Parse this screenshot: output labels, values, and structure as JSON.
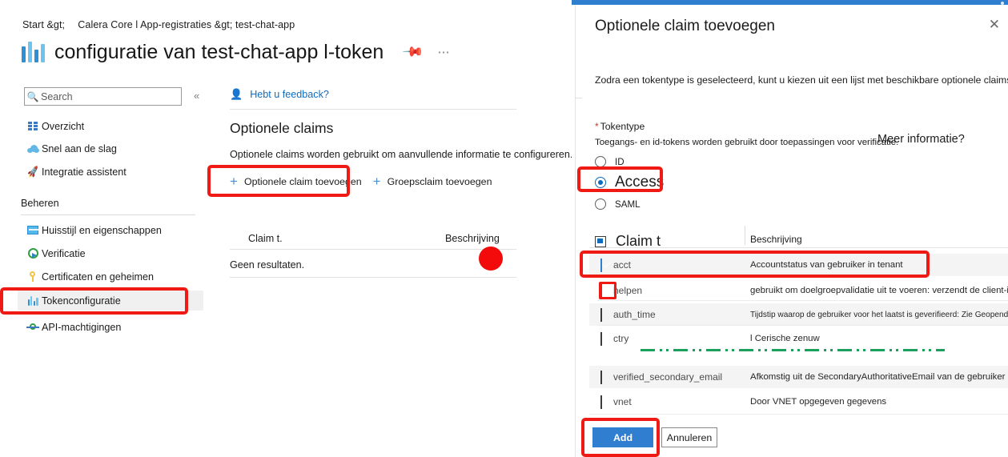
{
  "portal": {
    "breadcrumb": [
      "Start &gt;",
      "Calera Core l App-registraties &gt; test-chat-app"
    ],
    "page_title": "configuratie van test-chat-app l-token",
    "pin_icon": "pin-icon",
    "more_icon": "ellipsis-icon",
    "search": {
      "placeholder": "Search",
      "value": "",
      "icon": "search-icon"
    },
    "collapse_icon": "«",
    "nav": {
      "items": [
        {
          "label": "Overzicht",
          "icon": "grid-icon"
        },
        {
          "label": "Snel aan de slag",
          "icon": "cloud-icon"
        },
        {
          "label": "Integratie assistent",
          "icon": "rocket-icon"
        }
      ],
      "group_label": "Beheren",
      "manage_items": [
        {
          "label": "Huisstijl en eigenschappen",
          "icon": "branding-card-icon"
        },
        {
          "label": "Verificatie",
          "icon": "authentication-icon"
        },
        {
          "label": "Certificaten en geheimen",
          "icon": "key-icon"
        },
        {
          "label": "Tokenconfiguratie",
          "icon": "token-bars-icon",
          "selected": true
        },
        {
          "label": "API-machtigingen",
          "icon": "api-permissions-icon"
        }
      ]
    },
    "content": {
      "feedback_label": "Hebt u feedback?",
      "feedback_icon": "feedback-person-icon",
      "section_title": "Optionele claims",
      "section_desc": "Optionele claims worden gebruikt om aanvullende informatie te configureren.",
      "commands": [
        {
          "label": "Optionele claim toevoegen",
          "icon": "plus-icon"
        },
        {
          "label": "Groepsclaim toevoegen",
          "icon": "plus-icon"
        }
      ],
      "table": {
        "columns": [
          "Claim t.",
          "Beschrijving"
        ],
        "empty_text": "Geen resultaten."
      }
    }
  },
  "panel": {
    "title": "Optionele claim toevoegen",
    "close_icon": "close-icon",
    "description": "Zodra een tokentype is geselecteerd, kunt u kiezen uit een lijst met beschikbare optionele claims.",
    "tokentype": {
      "required_marker": "*",
      "label": "Tokentype",
      "help": "Toegangs- en id-tokens worden gebruikt door toepassingen voor verificatie.",
      "learn_more": "Meer informatie?",
      "options": [
        {
          "label": "ID",
          "selected": false
        },
        {
          "label": "Access",
          "selected": true
        },
        {
          "label": "SAML",
          "selected": false
        }
      ]
    },
    "table": {
      "select_all_state": "indeterminate",
      "columns": [
        "Claim t",
        "Beschrijving"
      ],
      "rows": [
        {
          "name": "acct",
          "desc": "Accountstatus van gebruiker in tenant",
          "checked": true,
          "alt": true
        },
        {
          "name": "helpen",
          "desc": "gebruikt om doelgroepvalidatie uit te voeren: verzendt de client-id…",
          "checked": false,
          "alt": false
        },
        {
          "name": "auth_time",
          "desc": "Tijdstip waarop de gebruiker voor het laatst is geverifieerd: Zie Geopende con…",
          "checked": false,
          "alt": true
        },
        {
          "name": "ctry",
          "desc": "l Cerische zenuw",
          "checked": false,
          "alt": false
        },
        {
          "name": "verified_secondary_email",
          "desc": "Afkomstig uit de SecondaryAuthoritativeEmail van de gebruiker",
          "checked": false,
          "alt": true
        },
        {
          "name": "vnet",
          "desc": "Door VNET opgegeven gegevens",
          "checked": false,
          "alt": false
        }
      ]
    },
    "buttons": {
      "primary": "Add",
      "secondary": "Annuleren"
    }
  },
  "annotations": {
    "accent_color": "#ef1a13",
    "dot_color": "#f30a0a",
    "break_color": "#1aa05a",
    "boxes": [
      {
        "name": "highlight-add-optional-claim"
      },
      {
        "name": "highlight-token-configuration-nav"
      },
      {
        "name": "highlight-access-radio"
      },
      {
        "name": "highlight-acct-row"
      },
      {
        "name": "highlight-helpen-checkbox"
      },
      {
        "name": "highlight-add-button"
      }
    ]
  }
}
